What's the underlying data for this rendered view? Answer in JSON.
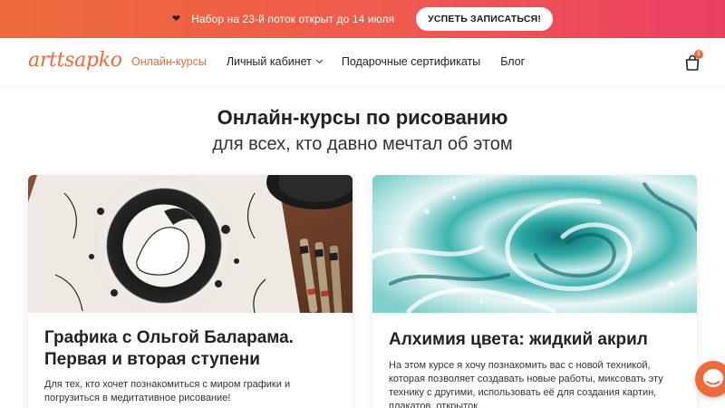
{
  "promo": {
    "icon": "heart-icon",
    "text": "Набор на 23-й поток открыт до 14 июля",
    "button_label": "УСПЕТЬ ЗАПИСАТЬСЯ!",
    "gradient_start": "#ee6a3a",
    "gradient_end": "#ec3f64"
  },
  "header": {
    "logo": "arttsapko",
    "nav": {
      "courses": "Онлайн-курсы",
      "account": "Личный кабинет",
      "certificates": "Подарочные сертификаты",
      "blog": "Блог"
    },
    "cart_icon": "shopping-bag-icon",
    "cart_count": "1"
  },
  "hero": {
    "title": "Онлайн-курсы по рисованию",
    "subtitle": "для всех, кто давно мечтал об этом"
  },
  "cards": [
    {
      "image": "ink-drawing-with-pens",
      "title": "Графика с Ольгой Баларама. Первая и вторая ступени",
      "description": "Для тех, кто хочет познакомиться с миром графики и погрузиться в медитативное рисование!"
    },
    {
      "image": "fluid-acrylic-swirl",
      "title": "Алхимия цвета: жидкий акрил",
      "description": "На этом курсе я хочу познакомить вас с новой техникой, которая позволяет создавать новые работы, миксовать эту технику с другими, использовать её для создания картин, плакатов, открыток."
    }
  ],
  "chat": {
    "icon": "chat-icon"
  },
  "colors": {
    "accent": "#ee6a3a",
    "text": "#222222"
  }
}
